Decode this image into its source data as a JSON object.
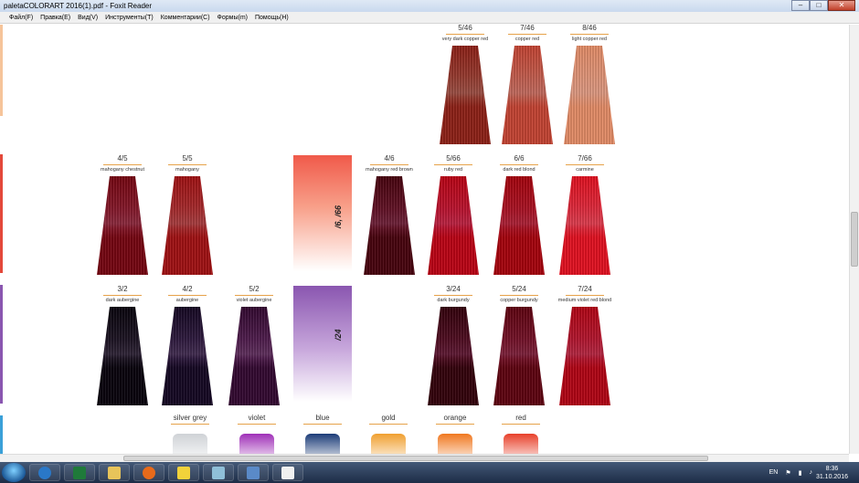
{
  "window": {
    "title": "paletaCOLORART 2016(1).pdf - Foxit Reader",
    "minimize": "–",
    "maximize": "□",
    "close": "✕"
  },
  "menu": [
    "Файл(F)",
    "Правка(E)",
    "Вид(V)",
    "Инструменты(T)",
    "Комментарии(C)",
    "Формы(m)",
    "Помощь(H)"
  ],
  "swatches_row1": [
    {
      "code": "5/46",
      "name": "very dark copper red",
      "color": "#8b3a30"
    },
    {
      "code": "7/46",
      "name": "copper red",
      "color": "#b8574a"
    },
    {
      "code": "8/46",
      "name": "light copper red",
      "color": "#d98a70"
    }
  ],
  "swatches_row2_left": [
    {
      "code": "4/5",
      "name": "mahogany chestnut",
      "color": "#7a1a2a"
    },
    {
      "code": "5/5",
      "name": "mahogany",
      "color": "#9a2a2c"
    }
  ],
  "block_66": {
    "label": "/6, /66",
    "top": "#f05a4a",
    "bottom": "#ffffff"
  },
  "swatches_row2_right": [
    {
      "code": "4/6",
      "name": "mahogany red brown",
      "color": "#5a1426"
    },
    {
      "code": "5/66",
      "name": "ruby red",
      "color": "#b0152e"
    },
    {
      "code": "6/6",
      "name": "dark red blond",
      "color": "#9e1424"
    },
    {
      "code": "7/66",
      "name": "carmine",
      "color": "#d82a3a"
    }
  ],
  "swatches_row3_left": [
    {
      "code": "3/2",
      "name": "dark aubergine",
      "color": "#1e1624"
    },
    {
      "code": "4/2",
      "name": "aubergine",
      "color": "#2e1c3c"
    },
    {
      "code": "5/2",
      "name": "violet aubergine",
      "color": "#4a1e48"
    }
  ],
  "block_24": {
    "label": "/24",
    "top": "#8a56b0",
    "bottom": "#ffffff"
  },
  "swatches_row3_right": [
    {
      "code": "3/24",
      "name": "dark burgundy",
      "color": "#4a0f22"
    },
    {
      "code": "5/24",
      "name": "copper burgundy",
      "color": "#6a1428"
    },
    {
      "code": "7/24",
      "name": "medium violet red blond",
      "color": "#a8182e"
    }
  ],
  "tones": [
    {
      "label": "silver grey",
      "color": "#cfd2d6"
    },
    {
      "label": "violet",
      "color": "#a030b8"
    },
    {
      "label": "blue",
      "color": "#1c3c78"
    },
    {
      "label": "gold",
      "color": "#f0a030"
    },
    {
      "label": "orange",
      "color": "#f07820"
    },
    {
      "label": "red",
      "color": "#e8402a"
    }
  ],
  "tray": {
    "lang": "EN",
    "time": "8:36",
    "date": "31.10.2016"
  }
}
